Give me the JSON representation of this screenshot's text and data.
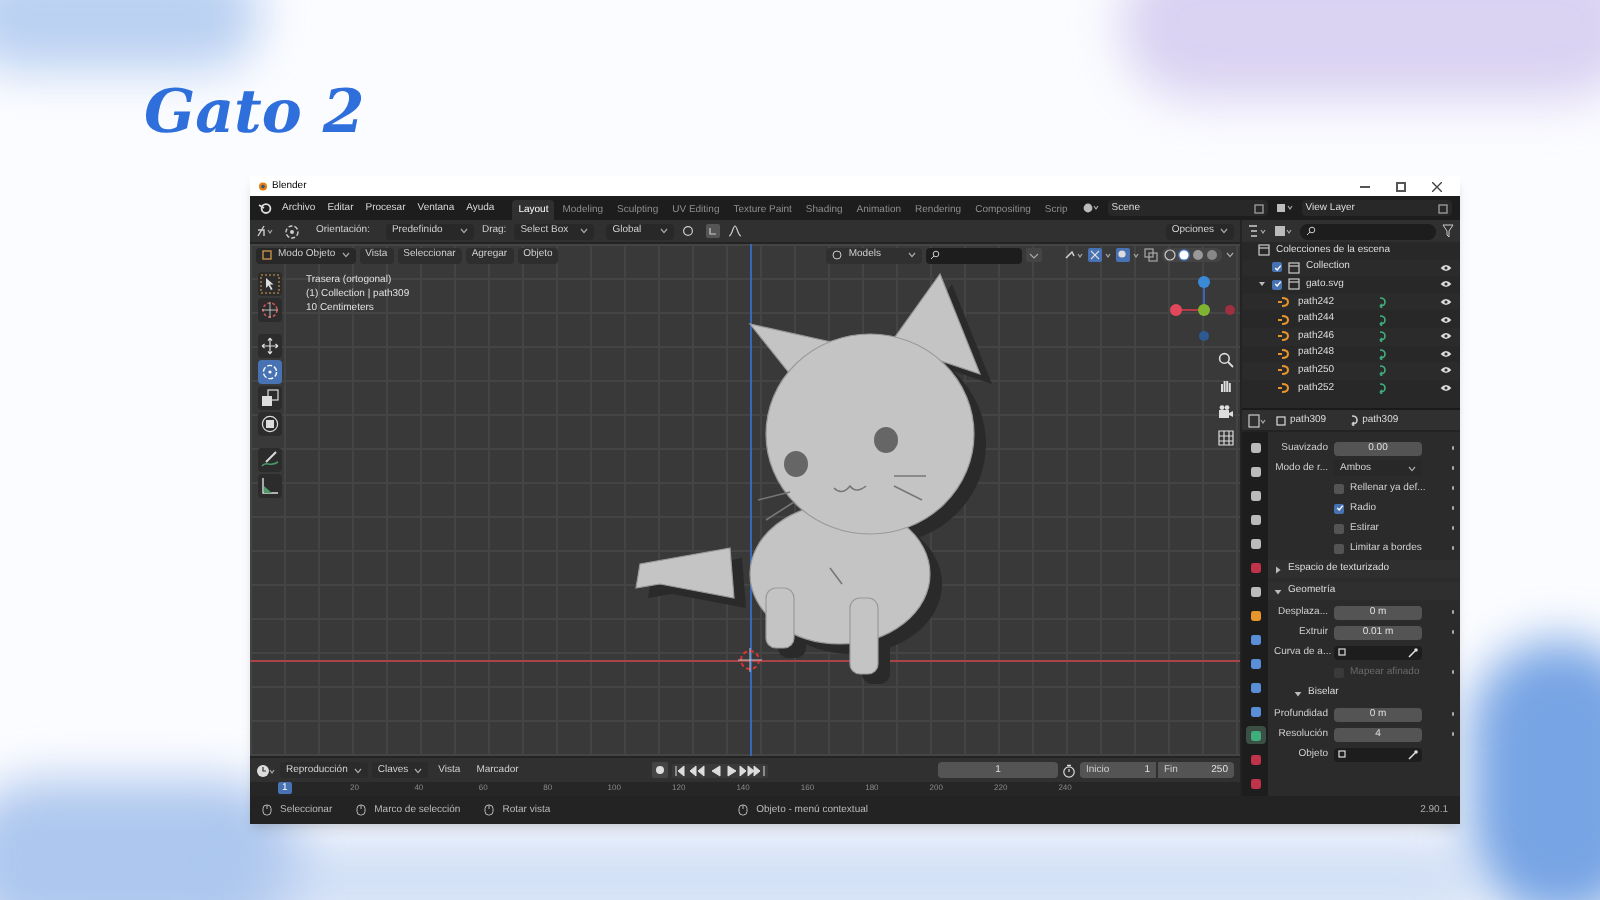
{
  "slide_title": "Gato 2",
  "window": {
    "title": "Blender"
  },
  "menu": [
    "Archivo",
    "Editar",
    "Procesar",
    "Ventana",
    "Ayuda"
  ],
  "workspace_tabs": [
    {
      "label": "Layout",
      "selected": true
    },
    {
      "label": "Modeling",
      "selected": false
    },
    {
      "label": "Sculpting",
      "selected": false
    },
    {
      "label": "UV Editing",
      "selected": false
    },
    {
      "label": "Texture Paint",
      "selected": false
    },
    {
      "label": "Shading",
      "selected": false
    },
    {
      "label": "Animation",
      "selected": false
    },
    {
      "label": "Rendering",
      "selected": false
    },
    {
      "label": "Compositing",
      "selected": false
    },
    {
      "label": "Scrip",
      "selected": false
    }
  ],
  "scene": "Scene",
  "view_layer": "View Layer",
  "tool_header": {
    "orientation_label": "Orientación:",
    "orientation": "Predefinido",
    "drag_label": "Drag:",
    "drag": "Select Box",
    "transform": "Global",
    "options": "Opciones"
  },
  "viewport_header": {
    "mode": "Modo Objeto",
    "menus": [
      "Vista",
      "Seleccionar",
      "Agregar",
      "Objeto"
    ],
    "collection": "Models"
  },
  "viewport_info": [
    "Trasera (ortogonal)",
    "(1) Collection | path309",
    "10 Centimeters"
  ],
  "tools": [
    {
      "kind": "select",
      "selected": false
    },
    {
      "kind": "cursor",
      "selected": false
    },
    {
      "kind": "move",
      "selected": false
    },
    {
      "kind": "rotate",
      "selected": true
    },
    {
      "kind": "scale",
      "selected": false
    },
    {
      "kind": "transform",
      "selected": false
    },
    {
      "kind": "annotate",
      "selected": false
    },
    {
      "kind": "measure",
      "selected": false
    }
  ],
  "outliner": {
    "title": "Colecciones de la escena",
    "items": [
      {
        "label": "Collection",
        "checked": true
      },
      {
        "label": "gato.svg",
        "checked": true,
        "children": [
          {
            "label": "path242"
          },
          {
            "label": "path244"
          },
          {
            "label": "path246"
          },
          {
            "label": "path248"
          },
          {
            "label": "path250"
          },
          {
            "label": "path252"
          }
        ]
      }
    ]
  },
  "properties": {
    "object": "path309",
    "data": "path309",
    "tabs": [
      {
        "kind": "tool",
        "selected": false
      },
      {
        "kind": "render",
        "selected": false
      },
      {
        "kind": "output",
        "selected": false
      },
      {
        "kind": "view_layer",
        "selected": false
      },
      {
        "kind": "scene",
        "selected": false
      },
      {
        "kind": "world",
        "selected": false
      },
      {
        "kind": "collection",
        "selected": false
      },
      {
        "kind": "object",
        "selected": false
      },
      {
        "kind": "modifiers",
        "selected": false
      },
      {
        "kind": "particles",
        "selected": false
      },
      {
        "kind": "physics",
        "selected": false
      },
      {
        "kind": "constraints",
        "selected": false
      },
      {
        "kind": "data",
        "selected": true
      },
      {
        "kind": "material",
        "selected": false
      },
      {
        "kind": "texture",
        "selected": false
      }
    ],
    "rows": [
      {
        "kind": "field",
        "label": "Suavizado",
        "value": "0.00"
      },
      {
        "kind": "dropdown",
        "label": "Modo de r...",
        "value": "Ambos"
      },
      {
        "kind": "checkbox",
        "label": "Rellenar ya def...",
        "checked": false,
        "disabled": false
      },
      {
        "kind": "checkbox",
        "label": "Radio",
        "checked": true,
        "disabled": false
      },
      {
        "kind": "checkbox",
        "label": "Estirar",
        "checked": false,
        "disabled": false
      },
      {
        "kind": "checkbox",
        "label": "Limitar a bordes",
        "checked": false,
        "disabled": false
      },
      {
        "kind": "section",
        "label": "Espacio de texturizado",
        "expanded": false
      },
      {
        "kind": "section",
        "label": "Geometría",
        "expanded": true
      },
      {
        "kind": "field",
        "label": "Desplaza...",
        "value": "0 m"
      },
      {
        "kind": "field",
        "label": "Extruir",
        "value": "0.01 m"
      },
      {
        "kind": "picker",
        "label": "Curva de a..."
      },
      {
        "kind": "checkbox",
        "label": "Mapear afinado",
        "checked": false,
        "disabled": true
      },
      {
        "kind": "subsection",
        "label": "Biselar",
        "expanded": true
      },
      {
        "kind": "field",
        "label": "Profundidad",
        "value": "0 m"
      },
      {
        "kind": "field",
        "label": "Resolución",
        "value": "4"
      },
      {
        "kind": "picker",
        "label": "Objeto"
      }
    ]
  },
  "timeline": {
    "menus": [
      "Reproducción",
      "Claves",
      "Vista",
      "Marcador"
    ],
    "current_frame": "1",
    "start_label": "Inicio",
    "start": "1",
    "end_label": "Fin",
    "end": "250",
    "marker": "1",
    "ruler": [
      "20",
      "40",
      "60",
      "80",
      "100",
      "120",
      "140",
      "160",
      "180",
      "200",
      "220",
      "240"
    ]
  },
  "status_bar": {
    "hints": [
      "Seleccionar",
      "Marco de selección",
      "Rotar vista",
      "Objeto - menú contextual"
    ],
    "version": "2.90.1"
  }
}
